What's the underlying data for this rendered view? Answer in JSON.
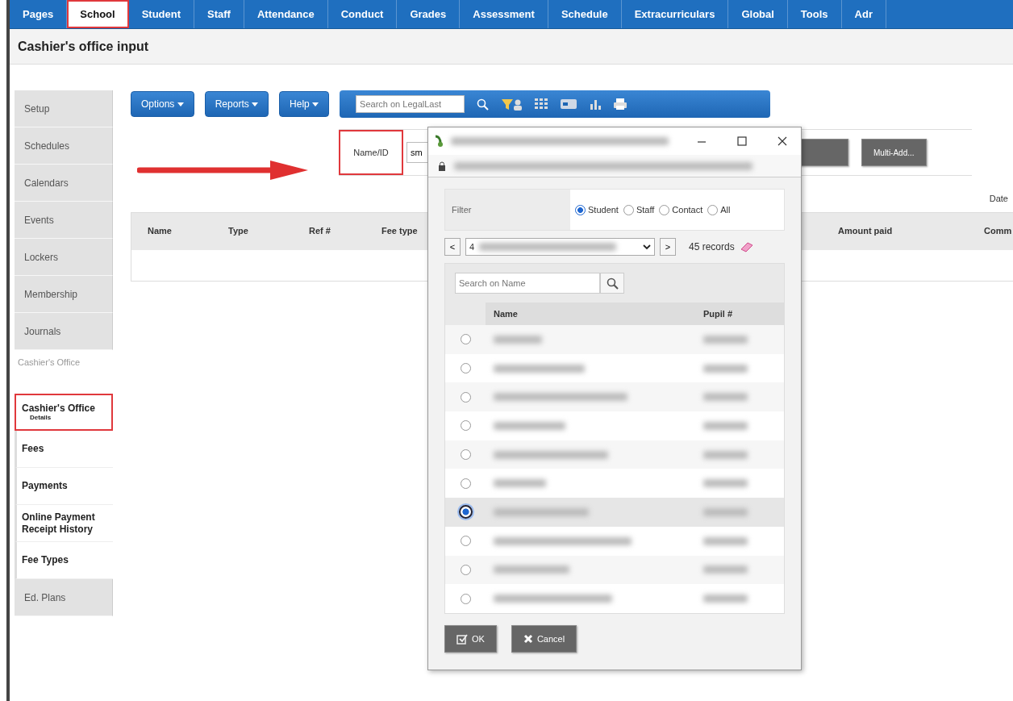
{
  "top_tabs": [
    {
      "label": "Pages",
      "selected": false,
      "highlighted": false
    },
    {
      "label": "School",
      "selected": true,
      "highlighted": true
    },
    {
      "label": "Student",
      "selected": false,
      "highlighted": false
    },
    {
      "label": "Staff",
      "selected": false,
      "highlighted": false
    },
    {
      "label": "Attendance",
      "selected": false,
      "highlighted": false
    },
    {
      "label": "Conduct",
      "selected": false,
      "highlighted": false
    },
    {
      "label": "Grades",
      "selected": false,
      "highlighted": false
    },
    {
      "label": "Assessment",
      "selected": false,
      "highlighted": false
    },
    {
      "label": "Schedule",
      "selected": false,
      "highlighted": false
    },
    {
      "label": "Extracurriculars",
      "selected": false,
      "highlighted": false
    },
    {
      "label": "Global",
      "selected": false,
      "highlighted": false
    },
    {
      "label": "Tools",
      "selected": false,
      "highlighted": false
    },
    {
      "label": "Adr",
      "selected": false,
      "highlighted": false
    }
  ],
  "page_title": "Cashier's office input",
  "sidebar": {
    "items": [
      {
        "kind": "tab",
        "label": "Setup"
      },
      {
        "kind": "tab",
        "label": "Schedules"
      },
      {
        "kind": "tab",
        "label": "Calendars"
      },
      {
        "kind": "tab",
        "label": "Events"
      },
      {
        "kind": "tab",
        "label": "Lockers"
      },
      {
        "kind": "tab",
        "label": "Membership"
      },
      {
        "kind": "tab",
        "label": "Journals"
      },
      {
        "kind": "heading",
        "label": "Cashier's Office"
      },
      {
        "kind": "subitem",
        "label": "Cashier's Office",
        "sublabel": "Details",
        "selected": true,
        "highlighted": true
      },
      {
        "kind": "subitem",
        "label": "Fees",
        "selected": false,
        "highlighted": false
      },
      {
        "kind": "subitem",
        "label": "Payments",
        "selected": false,
        "highlighted": false
      },
      {
        "kind": "subitem",
        "label": "Online Payment Receipt History",
        "selected": false,
        "highlighted": false
      },
      {
        "kind": "subitem",
        "label": "Fee Types",
        "selected": false,
        "highlighted": false
      },
      {
        "kind": "tab",
        "label": "Ed. Plans"
      }
    ]
  },
  "toolbar": {
    "menus": [
      "Options",
      "Reports",
      "Help"
    ],
    "search": {
      "placeholder": "Search on LegalLast"
    }
  },
  "entry": {
    "label": "Name/ID",
    "label_highlighted": true,
    "value": "sm",
    "buttons": [
      "Multi-Add..."
    ]
  },
  "date_label": "Date",
  "table": {
    "columns": [
      {
        "label": "Name"
      },
      {
        "label": "Type"
      },
      {
        "label": "Ref #"
      },
      {
        "label": "Fee type"
      },
      {
        "label": "Amount paid"
      },
      {
        "label": "Comm"
      }
    ]
  },
  "popup": {
    "filter": {
      "label": "Filter",
      "options": [
        {
          "label": "Student",
          "selected": true
        },
        {
          "label": "Staff",
          "selected": false
        },
        {
          "label": "Contact",
          "selected": false
        },
        {
          "label": "All",
          "selected": false
        }
      ]
    },
    "prev_label": "<",
    "next_label": ">",
    "page_select": "4",
    "records": "45 records",
    "search": {
      "placeholder": "Search on Name"
    },
    "columns": [
      "Name",
      "Pupil #"
    ],
    "rows": [
      {
        "selected": false
      },
      {
        "selected": false
      },
      {
        "selected": false
      },
      {
        "selected": false
      },
      {
        "selected": false
      },
      {
        "selected": false
      },
      {
        "selected": true
      },
      {
        "selected": false
      },
      {
        "selected": false
      },
      {
        "selected": false
      }
    ],
    "buttons": [
      {
        "kind": "ok",
        "label": "OK"
      },
      {
        "kind": "cancel",
        "label": "Cancel"
      }
    ]
  }
}
